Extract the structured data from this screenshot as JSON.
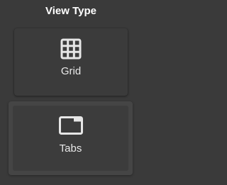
{
  "panel": {
    "title": "View Type"
  },
  "options": [
    {
      "label": "Grid",
      "icon": "grid-icon",
      "selected": false
    },
    {
      "label": "Tabs",
      "icon": "tabs-window-icon",
      "selected": true
    }
  ],
  "colors": {
    "background": "#3a3a3a",
    "icon": "#e6e6e6",
    "text": "#e9e9e9"
  }
}
